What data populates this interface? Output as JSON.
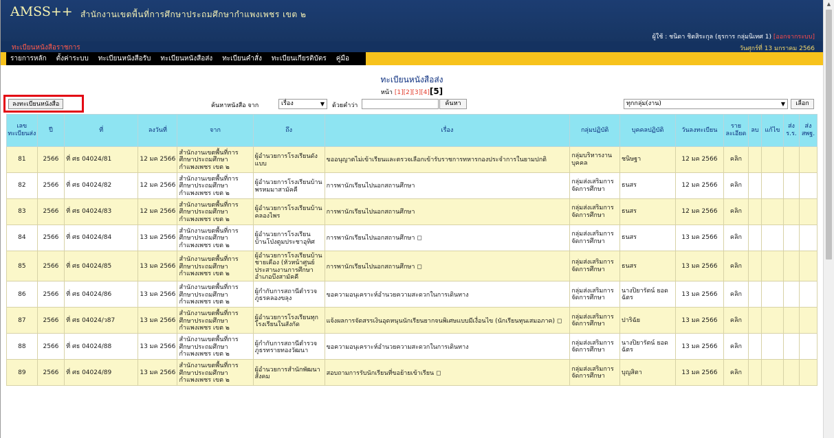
{
  "header": {
    "brand": "AMSS++",
    "org": "สำนักงานเขตพื้นที่การศึกษาประถมศึกษากำแพงเพชร เขต ๒",
    "user_text": "ผู้ใช้ : ชนิดา ชิตสิระกุล (ธุรการ กลุ่มนิเทศ 1)",
    "logout": "[ออกจากระบบ]",
    "module_title": "ทะเบียนหนังสือราชการ",
    "date": "วันศุกร์ที่ 13 มกราคม 2566"
  },
  "menu": [
    "รายการหลัก",
    "ตั้งค่าระบบ",
    "ทะเบียนหนังสือรับ",
    "ทะเบียนหนังสือส่ง",
    "ทะเบียนคำสั่ง",
    "ทะเบียนเกียรติบัตร",
    "คู่มือ"
  ],
  "page": {
    "heading": "ทะเบียนหนังสือส่ง",
    "pager_label": "หน้า",
    "pages": [
      "[1]",
      "[2]",
      "[3]",
      "[4]"
    ],
    "current_page": "[5]"
  },
  "toolbar": {
    "add_button": "ลงทะเบียนหนังสือ",
    "search_label": "ค้นหาหนังสือ จาก",
    "search_field": "เรื่อง",
    "keyword_label": "ด้วยคำว่า",
    "keyword_value": "",
    "search_button": "ค้นหา",
    "group_filter": "ทุกกลุ่ม(งาน)",
    "select_button": "เลือก"
  },
  "table": {
    "headers": [
      "เลขทะเบียนส่ง",
      "ปี",
      "ที่",
      "ลงวันที่",
      "จาก",
      "ถึง",
      "เรื่อง",
      "กลุ่มปฏิบัติ",
      "บุคคลปฏิบัติ",
      "วันลงทะเบียน",
      "รายละเอียด",
      "ลบ",
      "แก้ไข",
      "ส่ง ร.ร.",
      "ส่ง สพฐ."
    ],
    "rows": [
      {
        "no": "81",
        "year": "2566",
        "ref": "ที่ ศธ 04024/81",
        "date": "12 มค 2566",
        "from": "สำนักงานเขตพื้นที่การศึกษาประถมศึกษากำแพงเพชร เขต ๒",
        "to": "ผู้อำนวยการโรงเรียนดังแบบ",
        "subject": "ขออนุญาตไม่เข้าเรียนและตรวจเลือกเข้ารับราชการทหารกองประจำการในยามปกติ",
        "group": "กลุ่มบริหารงานบุคคล",
        "person": "ชนิษฐา",
        "reg_date": "12 มค 2566",
        "detail": "คลิก"
      },
      {
        "no": "82",
        "year": "2566",
        "ref": "ที่ ศธ 04024/82",
        "date": "12 มค 2566",
        "from": "สำนักงานเขตพื้นที่การศึกษาประถมศึกษากำแพงเพชร เขต ๒",
        "to": "ผู้อำนวยการโรงเรียนบ้านพรหมมาสามัคคี",
        "subject": "การพานักเรียนไปนอกสถานศึกษา",
        "group": "กลุ่มส่งเสริมการจัดการศึกษา",
        "person": "ธนสร",
        "reg_date": "12 มค 2566",
        "detail": "คลิก"
      },
      {
        "no": "83",
        "year": "2566",
        "ref": "ที่ ศธ 04024/83",
        "date": "12 มค 2566",
        "from": "สำนักงานเขตพื้นที่การศึกษาประถมศึกษากำแพงเพชร เขต ๒",
        "to": "ผู้อำนวยการโรงเรียนบ้านคลองไพร",
        "subject": "การพานักเรียนไปนอกสถานศึกษา",
        "group": "กลุ่มส่งเสริมการจัดการศึกษา",
        "person": "ธนสร",
        "reg_date": "12 มค 2566",
        "detail": "คลิก"
      },
      {
        "no": "84",
        "year": "2566",
        "ref": "ที่ ศธ 04024/84",
        "date": "13 มค 2566",
        "from": "สำนักงานเขตพื้นที่การศึกษาประถมศึกษากำแพงเพชร เขต ๒",
        "to": "ผู้อำนวยการโรงเรียนบ้านโป่งตูมประชาอุทิศ",
        "subject": "การพานักเรียนไปนอกสถานศึกษา ◻",
        "group": "กลุ่มส่งเสริมการจัดการศึกษา",
        "person": "ธนสร",
        "reg_date": "13 มค 2566",
        "detail": "คลิก"
      },
      {
        "no": "85",
        "year": "2566",
        "ref": "ที่ ศธ 04024/85",
        "date": "13 มค 2566",
        "from": "สำนักงานเขตพื้นที่การศึกษาประถมศึกษากำแพงเพชร เขต ๒",
        "to": "ผู้อำนวยการโรงเรียนบ้านชายเคือง (หัวหน้าศูนย์ประสานงานการศึกษาอำเภอบึงสามัคคี",
        "subject": "การพานักเรียนไปนอกสถานศึกษา ◻",
        "group": "กลุ่มส่งเสริมการจัดการศึกษา",
        "person": "ธนสร",
        "reg_date": "13 มค 2566",
        "detail": "คลิก"
      },
      {
        "no": "86",
        "year": "2566",
        "ref": "ที่ ศธ 04024/86",
        "date": "13 มค 2566",
        "from": "สำนักงานเขตพื้นที่การศึกษาประถมศึกษากำแพงเพชร เขต ๒",
        "to": "ผู้กำกับการสถานีตำรวจภูธรคลองขลุง",
        "subject": "ขอความอนุเคราะห์อำนวยความสะดวกในการเดินทาง",
        "group": "กลุ่มส่งเสริมการจัดการศึกษา",
        "person": "นางปิยารัตน์ ยอดฉัตร",
        "reg_date": "13 มค 2566",
        "detail": "คลิก"
      },
      {
        "no": "87",
        "year": "2566",
        "ref": "ที่ ศธ 04024/ว87",
        "date": "13 มค 2566",
        "from": "สำนักงานเขตพื้นที่การศึกษาประถมศึกษากำแพงเพชร เขต ๒",
        "to": "ผู้อำนวยการโรงเรียนทุกโรงเรียนในสังกัด",
        "subject": "แจ้งผลการจัดสรรเงินอุดหนุนนักเรียนยากจนพิเศษแบบมีเงื่อนไข (นักเรียนทุนเสมอภาค) ◻",
        "group": "กลุ่มส่งเสริมการจัดการศึกษา",
        "person": "ปาริฉัย",
        "reg_date": "13 มค 2566",
        "detail": "คลิก"
      },
      {
        "no": "88",
        "year": "2566",
        "ref": "ที่ ศธ 04024/88",
        "date": "13 มค 2566",
        "from": "สำนักงานเขตพื้นที่การศึกษาประถมศึกษากำแพงเพชร เขต ๒",
        "to": "ผู้กำกับการสถานีตำรวจภูธรทรายทองวัฒนา",
        "subject": "ขอความอนุเคราะห์อำนวยความสะดวกในการเดินทาง",
        "group": "กลุ่มส่งเสริมการจัดการศึกษา",
        "person": "นางปิยารัตน์ ยอดฉัตร",
        "reg_date": "13 มค 2566",
        "detail": "คลิก"
      },
      {
        "no": "89",
        "year": "2566",
        "ref": "ที่ ศธ 04024/89",
        "date": "13 มค 2566",
        "from": "สำนักงานเขตพื้นที่การศึกษาประถมศึกษากำแพงเพชร เขต ๒",
        "to": "ผู้อำนวยการสำนักพัฒนาสังคม",
        "subject": "สอบถามการรับนักเรียนที่ขอย้ายเข้าเรียน ◻",
        "group": "กลุ่มส่งเสริมการจัดการศึกษา",
        "person": "บุญสิตา",
        "reg_date": "13 มค 2566",
        "detail": "คลิก"
      }
    ]
  }
}
